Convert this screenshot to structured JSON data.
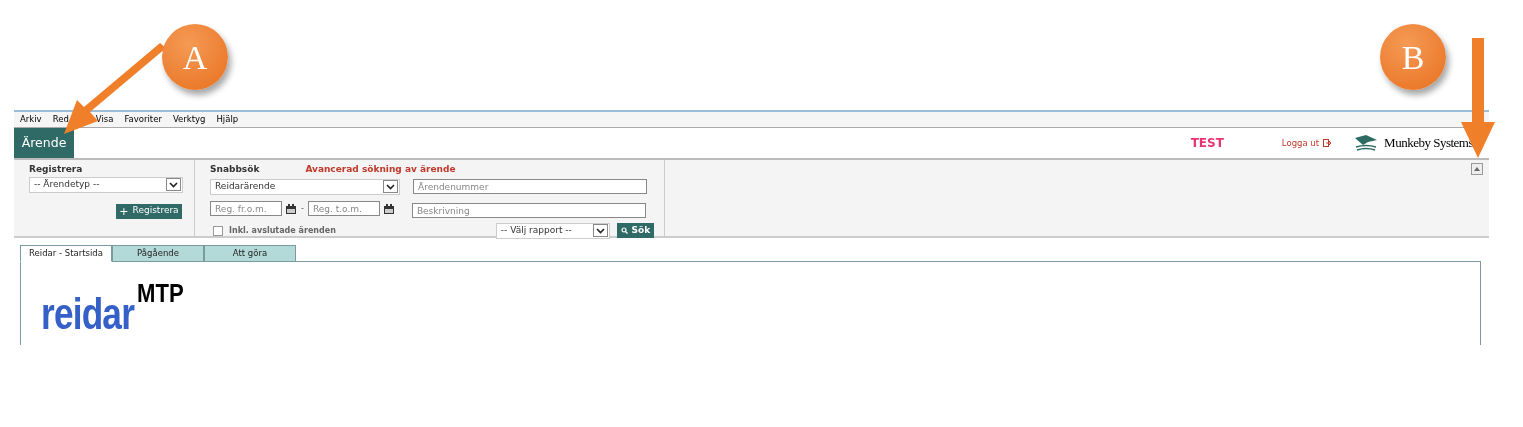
{
  "menu": [
    "Arkiv",
    "Red",
    "Visa",
    "Favoriter",
    "Verktyg",
    "Hjälp"
  ],
  "header": {
    "module_tab": "Ärende",
    "environment": "TEST",
    "logout": "Logga ut",
    "brand": "Munkeby Systems"
  },
  "register": {
    "title": "Registrera",
    "type_select": "-- Ärendetyp --",
    "button_icon": "+",
    "button": "Registrera"
  },
  "quick_search": {
    "title": "Snabbsök",
    "advanced_link": "Avancerad sökning av ärende",
    "type_select": "Reidarärende",
    "number_field": {
      "placeholder": "Ärendenummer"
    },
    "from_field": {
      "placeholder": "Reg. fr.o.m."
    },
    "separator": "-",
    "to_field": {
      "placeholder": "Reg. t.o.m."
    },
    "description_field": {
      "placeholder": "Beskrivning"
    },
    "include_closed": {
      "label": "Inkl. avslutade ärenden",
      "checked": false
    },
    "report_select": "-- Välj rapport --",
    "search_button": "Sök"
  },
  "tabs": [
    {
      "label": "Reidar - Startsida",
      "selected": true
    },
    {
      "label": "Pågående",
      "selected": false
    },
    {
      "label": "Att göra",
      "selected": false
    }
  ],
  "content": {
    "logo_main": "reidar",
    "logo_super": "MTP"
  },
  "annotations": [
    {
      "label": "A"
    },
    {
      "label": "B"
    }
  ]
}
